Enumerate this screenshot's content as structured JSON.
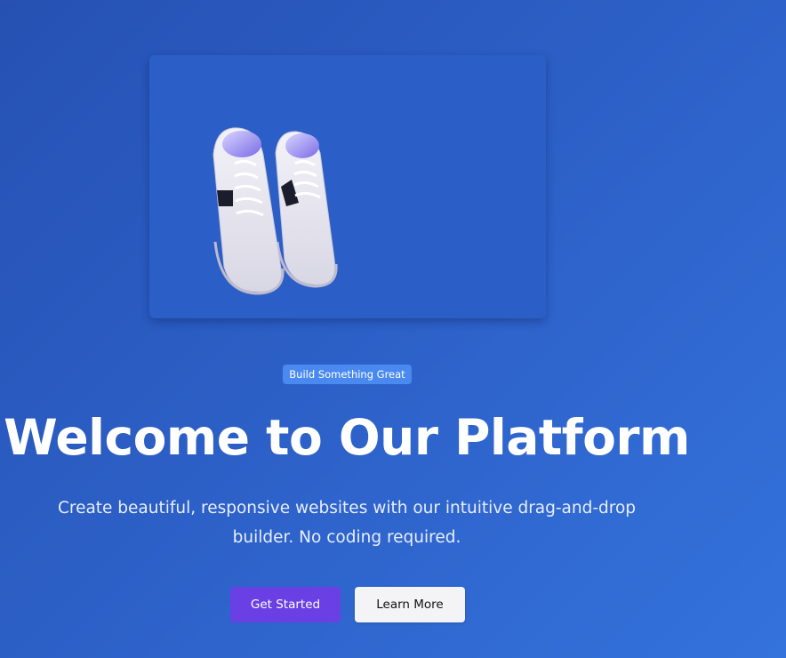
{
  "hero": {
    "image_alt": "sneakers-photo",
    "badge": "Build Something Great",
    "title": "Welcome to Our Platform",
    "subtitle": "Create beautiful, responsive websites with our intuitive drag-and-drop builder. No coding required."
  },
  "actions": {
    "primary_label": "Get Started",
    "secondary_label": "Learn More"
  },
  "colors": {
    "background_start": "#2651b3",
    "background_end": "#3472dc",
    "badge": "#4a8af0",
    "primary_button": "#6a3fe4",
    "secondary_button": "#f4f4f6"
  }
}
